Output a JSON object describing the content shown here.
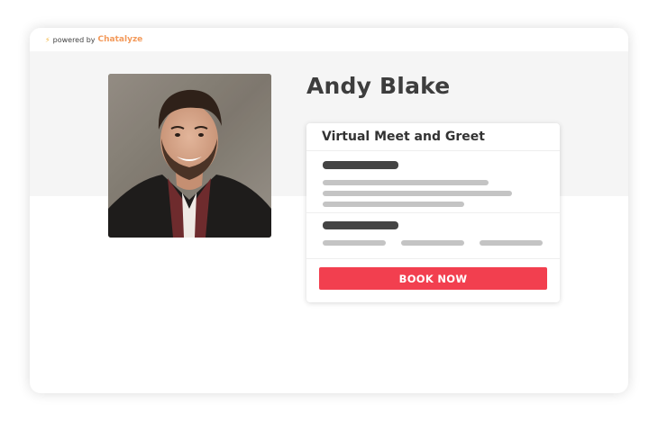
{
  "header": {
    "powered_by": "powered by",
    "brand": "Chatalyze",
    "bolt_icon": "lightning-bolt-icon"
  },
  "profile": {
    "name": "Andy Blake"
  },
  "event_card": {
    "title": "Virtual Meet and Greet",
    "cta_label": "BOOK NOW"
  },
  "colors": {
    "brand": "#f39a5b",
    "cta": "#f23f4f",
    "band": "#f5f5f5",
    "heading": "#3d3d3d"
  }
}
